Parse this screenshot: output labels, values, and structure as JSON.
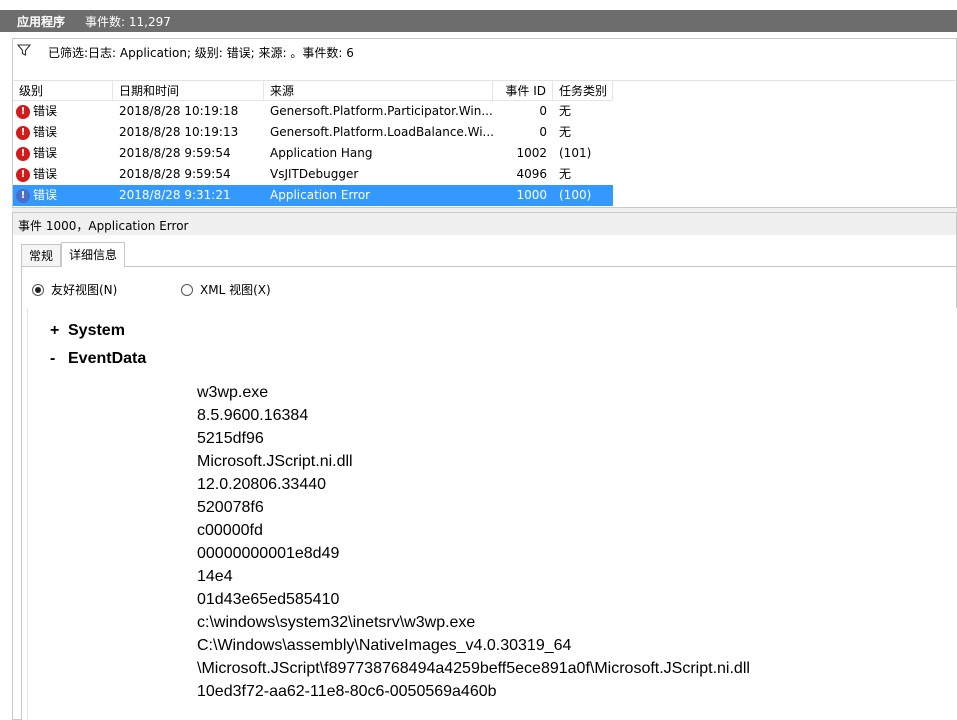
{
  "titlebar": {
    "app": "应用程序",
    "event_count": "事件数: 11,297"
  },
  "filter": {
    "icon": "filter-icon",
    "text": "已筛选:日志: Application; 级别: 错误; 来源: 。事件数: 6"
  },
  "grid": {
    "headers": [
      "级别",
      "日期和时间",
      "来源",
      "事件 ID",
      "任务类别"
    ],
    "rows": [
      {
        "level": "错误",
        "date": "2018/8/28 10:19:18",
        "source": "Genersoft.Platform.Participator.Win...",
        "id": "0",
        "category": "无",
        "selected": false
      },
      {
        "level": "错误",
        "date": "2018/8/28 10:19:13",
        "source": "Genersoft.Platform.LoadBalance.Wi...",
        "id": "0",
        "category": "无",
        "selected": false
      },
      {
        "level": "错误",
        "date": "2018/8/28 9:59:54",
        "source": "Application Hang",
        "id": "1002",
        "category": "(101)",
        "selected": false
      },
      {
        "level": "错误",
        "date": "2018/8/28 9:59:54",
        "source": "VsJITDebugger",
        "id": "4096",
        "category": "无",
        "selected": false
      },
      {
        "level": "错误",
        "date": "2018/8/28 9:31:21",
        "source": "Application Error",
        "id": "1000",
        "category": "(100)",
        "selected": true
      }
    ]
  },
  "detail": {
    "title": "事件 1000，Application Error",
    "tabs": [
      "常规",
      "详细信息"
    ],
    "active_tab": "详细信息",
    "view_friendly": "友好视图(N)",
    "view_xml": "XML 视图(X)",
    "nodes": [
      {
        "sign": "+",
        "label": "System"
      },
      {
        "sign": "-",
        "label": "EventData"
      }
    ],
    "event_values": [
      "w3wp.exe",
      "8.5.9600.16384",
      "5215df96",
      "Microsoft.JScript.ni.dll",
      "12.0.20806.33440",
      "520078f6",
      "c00000fd",
      "00000000001e8d49",
      "14e4",
      "01d43e65ed585410",
      "c:\\windows\\system32\\inetsrv\\w3wp.exe",
      "C:\\Windows\\assembly\\NativeImages_v4.0.30319_64",
      "\\Microsoft.JScript\\f897738768494a4259beff5ece891a0f\\Microsoft.JScript.ni.dll",
      "10ed3f72-aa62-11e8-80c6-0050569a460b"
    ]
  },
  "colors": {
    "titlebar_bg": "#6d6d6d",
    "selection": "#3399ff",
    "error_icon": "#d21b1b"
  }
}
